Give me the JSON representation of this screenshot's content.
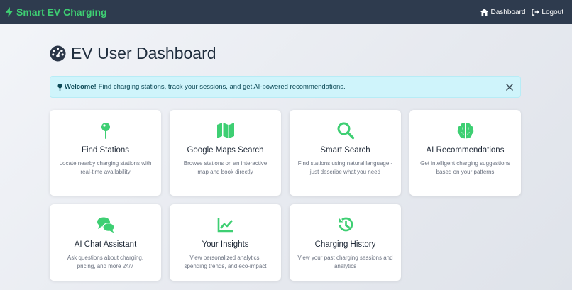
{
  "nav": {
    "brand": "Smart EV Charging",
    "links": [
      {
        "label": "Dashboard",
        "icon": "home-icon"
      },
      {
        "label": "Logout",
        "icon": "logout-icon"
      }
    ]
  },
  "page": {
    "title": "EV User Dashboard"
  },
  "alert": {
    "strong": "Welcome!",
    "text": "Find charging stations, track your sessions, and get AI-powered recommendations."
  },
  "cards": [
    {
      "title": "Find Stations",
      "desc": "Locate nearby charging stations with real-time availability",
      "icon": "map-pin-icon"
    },
    {
      "title": "Google Maps Search",
      "desc": "Browse stations on an interactive map and book directly",
      "icon": "map-icon"
    },
    {
      "title": "Smart Search",
      "desc": "Find stations using natural language - just describe what you need",
      "icon": "search-icon"
    },
    {
      "title": "AI Recommendations",
      "desc": "Get intelligent charging suggestions based on your patterns",
      "icon": "brain-icon"
    },
    {
      "title": "AI Chat Assistant",
      "desc": "Ask questions about charging, pricing, and more 24/7",
      "icon": "chat-icon"
    },
    {
      "title": "Your Insights",
      "desc": "View personalized analytics, spending trends, and eco-impact",
      "icon": "chart-line-icon"
    },
    {
      "title": "Charging History",
      "desc": "View your past charging sessions and analytics",
      "icon": "history-icon"
    }
  ],
  "colors": {
    "navbar": "#2e3b4e",
    "accent": "#3ecf73",
    "alert_bg": "#cff4fb"
  }
}
